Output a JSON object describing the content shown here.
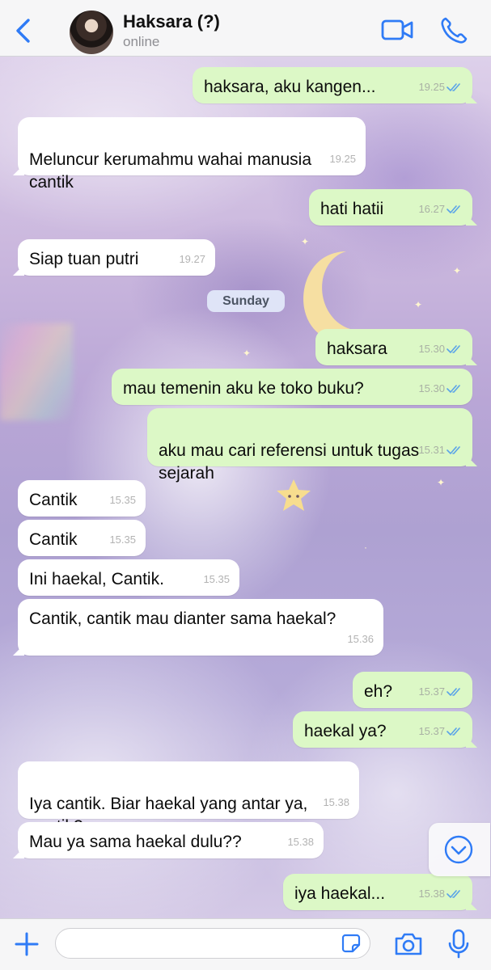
{
  "header": {
    "contact_name": "Haksara (?)",
    "status": "online"
  },
  "chat": {
    "date_separator": "Sunday",
    "messages": [
      {
        "direction": "outgoing",
        "text": "haksara, aku kangen...",
        "time": "19.25",
        "read": true
      },
      {
        "direction": "incoming",
        "text": "Meluncur kerumahmu wahai manusia\ncantik",
        "time": "19.25"
      },
      {
        "direction": "outgoing",
        "text": "hati hatii",
        "time": "16.27",
        "read": true
      },
      {
        "direction": "incoming",
        "text": "Siap tuan putri",
        "time": "19.27"
      },
      {
        "direction": "outgoing",
        "text": "haksara",
        "time": "15.30",
        "read": true
      },
      {
        "direction": "outgoing",
        "text": "mau temenin aku ke toko buku?",
        "time": "15.30",
        "read": true
      },
      {
        "direction": "outgoing",
        "text": "aku mau cari referensi untuk tugas\nsejarah",
        "time": "15.31",
        "read": true
      },
      {
        "direction": "incoming",
        "text": "Cantik",
        "time": "15.35"
      },
      {
        "direction": "incoming",
        "text": "Cantik",
        "time": "15.35"
      },
      {
        "direction": "incoming",
        "text": "Ini haekal, Cantik.",
        "time": "15.35"
      },
      {
        "direction": "incoming",
        "text": "Cantik, cantik mau dianter sama haekal?",
        "time": "15.36"
      },
      {
        "direction": "outgoing",
        "text": "eh?",
        "time": "15.37",
        "read": true
      },
      {
        "direction": "outgoing",
        "text": "haekal ya?",
        "time": "15.37",
        "read": true
      },
      {
        "direction": "incoming",
        "text": "Iya cantik. Biar haekal yang antar ya,\ncantik?",
        "time": "15.38"
      },
      {
        "direction": "incoming",
        "text": "Mau ya sama haekal dulu??",
        "time": "15.38"
      },
      {
        "direction": "outgoing",
        "text": "iya haekal...",
        "time": "15.38",
        "read": true
      }
    ]
  },
  "input": {
    "value": ""
  },
  "colors": {
    "accent": "#2f7bf6",
    "outgoing_bubble": "#dcf8c6",
    "incoming_bubble": "#ffffff",
    "read_ticks": "#5aa3e8"
  },
  "icons": {
    "back": "chevron-left-icon",
    "video": "video-camera-icon",
    "call": "phone-icon",
    "add": "plus-icon",
    "sticker": "sticker-icon",
    "camera": "camera-icon",
    "mic": "microphone-icon",
    "scroll": "chevron-down-circle-icon"
  }
}
